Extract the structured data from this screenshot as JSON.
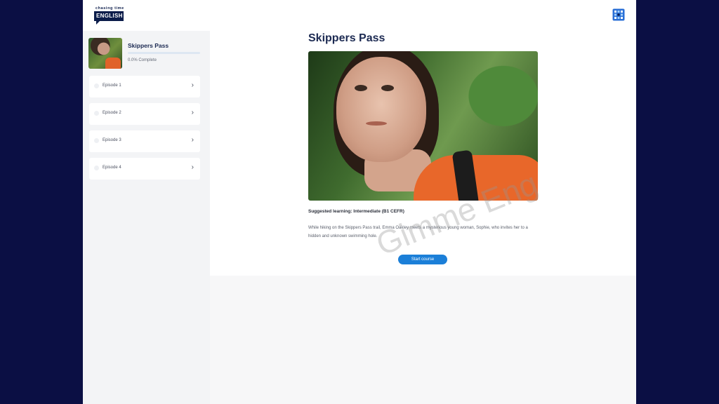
{
  "header": {
    "logo_top": "chasing time",
    "logo_main": "ENGLISH",
    "menu_icon": "grid-icon"
  },
  "sidebar": {
    "course_title": "Skippers Pass",
    "progress_percent": 0,
    "progress_text": "0.0% Complete",
    "episodes": [
      {
        "label": "Episode 1"
      },
      {
        "label": "Episode 2"
      },
      {
        "label": "Episode 3"
      },
      {
        "label": "Episode 4"
      }
    ]
  },
  "main": {
    "title": "Skippers Pass",
    "suggested": "Suggested learning: Intermediate (B1 CEFR)",
    "description": "While hiking on the Skippers Pass trail, Emma Oakley meets a mysterious young woman, Sophie, who invites her to a hidden and unknown swimming hole.",
    "start_label": "Start course"
  },
  "watermark": "Gimme Eng",
  "colors": {
    "accent": "#1b7fd8",
    "navy": "#1c2a52",
    "background_outer": "#0b0f44"
  }
}
